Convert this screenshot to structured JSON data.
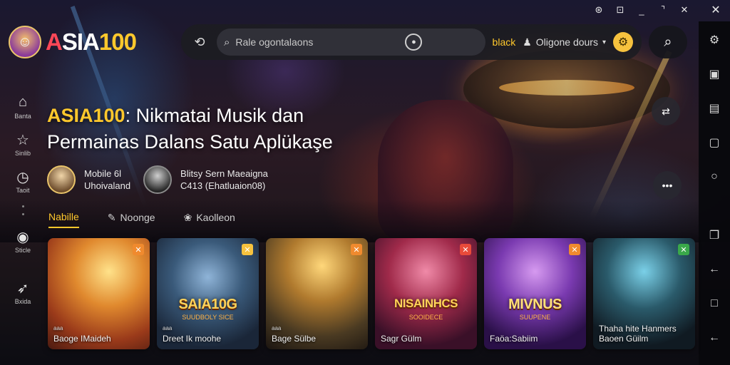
{
  "brand": {
    "logo_icon": "jester-avatar-icon",
    "parts": [
      "A",
      "SIA",
      "100"
    ],
    "colors": {
      "accent": "#ffc82c",
      "red": "#ff4757",
      "white": "#ffffff"
    }
  },
  "window_controls": [
    "help-icon",
    "restore-icon",
    "minimize-icon",
    "close-icon",
    "close-x-icon"
  ],
  "topbar": {
    "search_placeholder": "Rale ogontalaons",
    "black_label": "black",
    "people_label": "Oligone dours",
    "dropdown_symbol": "▾"
  },
  "sidebar": {
    "items": [
      {
        "label": "Banta",
        "icon": "home-icon"
      },
      {
        "label": "Sinlib",
        "icon": "star-icon"
      },
      {
        "label": "Taoit",
        "icon": "timer-icon"
      },
      {
        "label": "Sticle",
        "icon": "disc-icon"
      },
      {
        "label": "Bxida",
        "icon": "rocket-icon"
      }
    ]
  },
  "hero": {
    "brand": "ASIA100",
    "title_rest": ": Nikmatai Musik dan",
    "title_line2": "Permainas Dalans Satu Aplükaşe"
  },
  "users": [
    {
      "line1": "Mobile 6l",
      "line2": "Uhoivaland"
    },
    {
      "line1": "Blitsy Sern Maeaigna",
      "line2": "C413 (Ehatluaion08)"
    }
  ],
  "tabs": [
    {
      "label": "Nabille",
      "active": true
    },
    {
      "label": "Noonge",
      "icon": "pencil-icon"
    },
    {
      "label": "Kaolleon",
      "icon": "paw-icon"
    }
  ],
  "cards": [
    {
      "title_art": "",
      "sub_art": "",
      "tag": "aaa",
      "name": "Baoge IMaideh",
      "badge_color": "#f08a2e",
      "badge_icon": "x-icon"
    },
    {
      "title_art": "SAIA10G",
      "sub_art": "SUUDBOLY SICE",
      "tag": "aaa",
      "name": "Dreet Ik moohe",
      "badge_color": "#f6c23e",
      "badge_icon": "x-icon"
    },
    {
      "title_art": "",
      "sub_art": "",
      "tag": "aaa",
      "name": "Bage Sülbe",
      "badge_color": "#f08a2e",
      "badge_icon": "x-icon"
    },
    {
      "title_art": "NISAINHCS",
      "sub_art": "SOOIDECE",
      "tag": "",
      "name": "Sagr Gülm",
      "badge_color": "#e84a3a",
      "badge_icon": "x-icon"
    },
    {
      "title_art": "MIVNUS",
      "sub_art": "SUUPENE",
      "tag": "",
      "name": "Faöa:Sabiim",
      "badge_color": "#f08a2e",
      "badge_icon": "x-icon"
    },
    {
      "title_art": "",
      "sub_art": "",
      "tag": "",
      "name": "Thaha hite Hanmers",
      "name2": "Baoen Güilm",
      "badge_color": "#3aa84a",
      "badge_icon": "x-icon"
    }
  ]
}
